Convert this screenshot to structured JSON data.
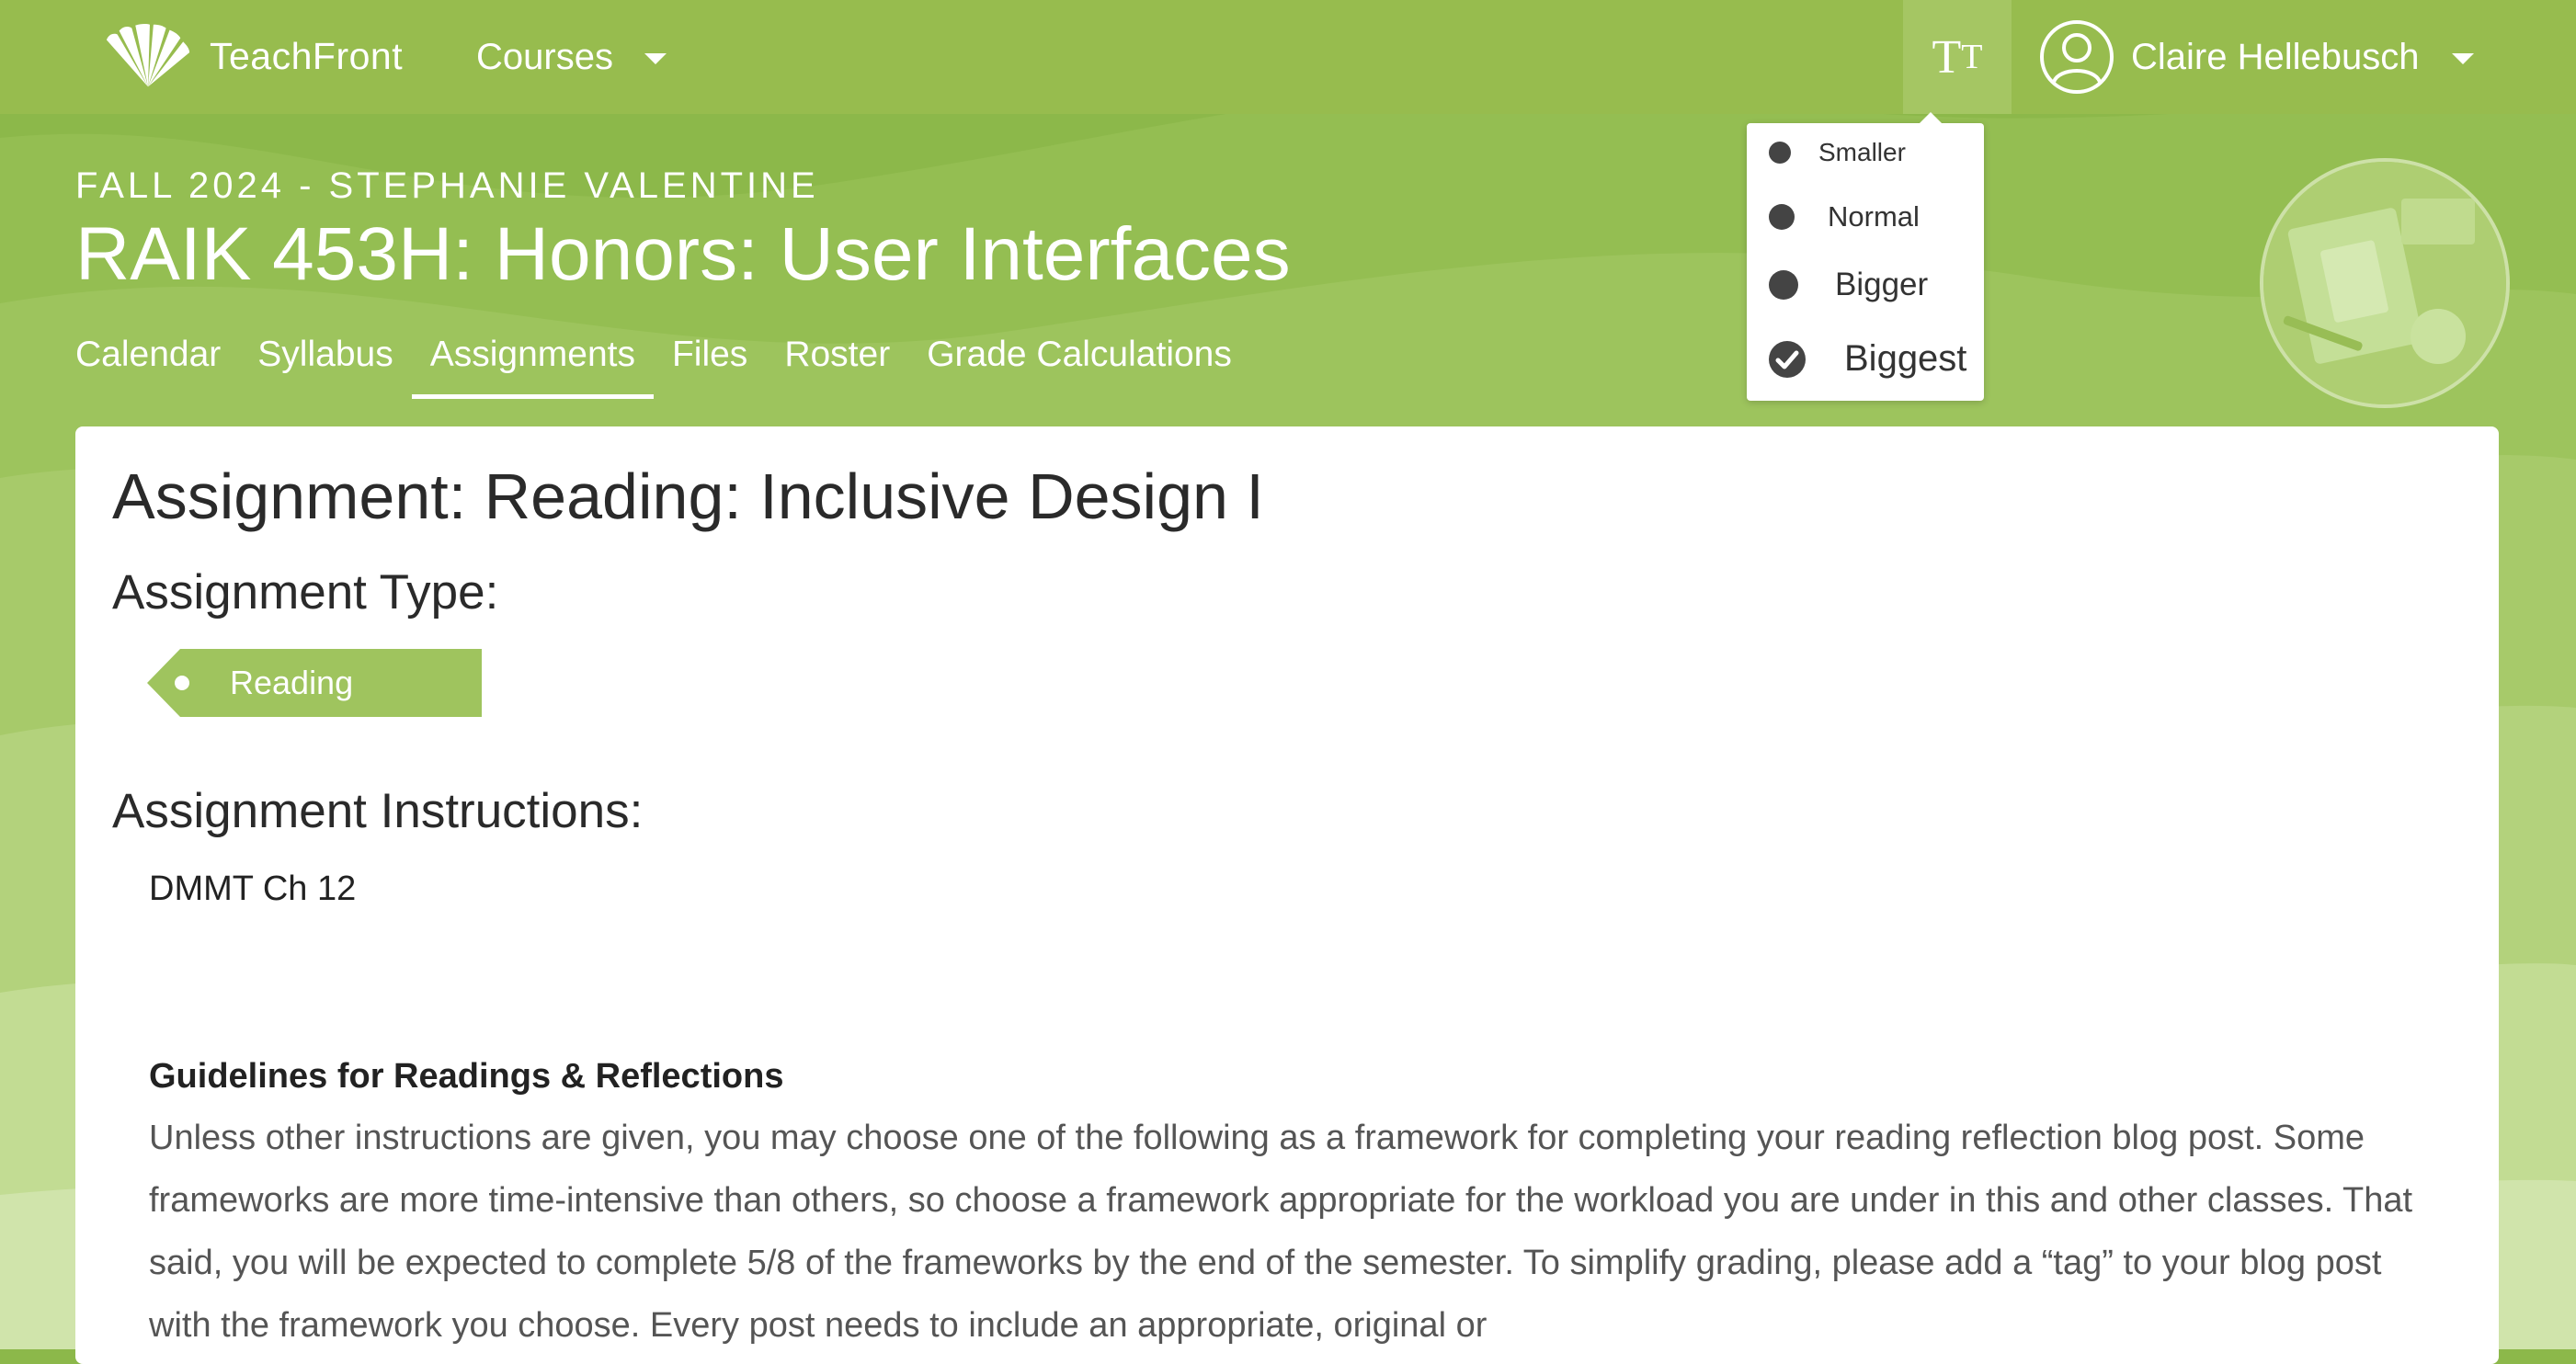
{
  "navbar": {
    "brand_name": "TeachFront",
    "courses_label": "Courses",
    "font_size_glyph_large": "T",
    "font_size_glyph_small": "T",
    "user_name": "Claire Hellebusch"
  },
  "font_size_menu": {
    "options": [
      "Smaller",
      "Normal",
      "Bigger",
      "Biggest"
    ],
    "selected": "Biggest"
  },
  "course": {
    "term": "FALL 2024 - STEPHANIE VALENTINE",
    "title": "RAIK 453H: Honors: User Interfaces",
    "tabs": [
      "Calendar",
      "Syllabus",
      "Assignments",
      "Files",
      "Roster",
      "Grade Calculations"
    ],
    "active_tab": "Assignments"
  },
  "assignment": {
    "title": "Assignment: Reading: Inclusive Design I",
    "type_heading": "Assignment Type:",
    "type_value": "Reading",
    "instructions_heading": "Assignment Instructions:",
    "instructions_text": "DMMT Ch 12",
    "guidelines_heading": "Guidelines for Readings & Reflections",
    "guidelines_body": "Unless other instructions are given, you may choose one of the following as a framework for completing your reading reflection blog post. Some frameworks are more time-intensive than others, so choose a framework appropriate for the workload you are under in this and other classes. That said, you will be expected to complete 5/8 of the frameworks by the end of the semester. To simplify grading, please add a “tag” to your blog post with the framework you choose. Every post needs to include an appropriate, original or"
  },
  "colors": {
    "navbar": "#97bc4e",
    "accent": "#9fc45e",
    "background": "#8cb84a"
  }
}
